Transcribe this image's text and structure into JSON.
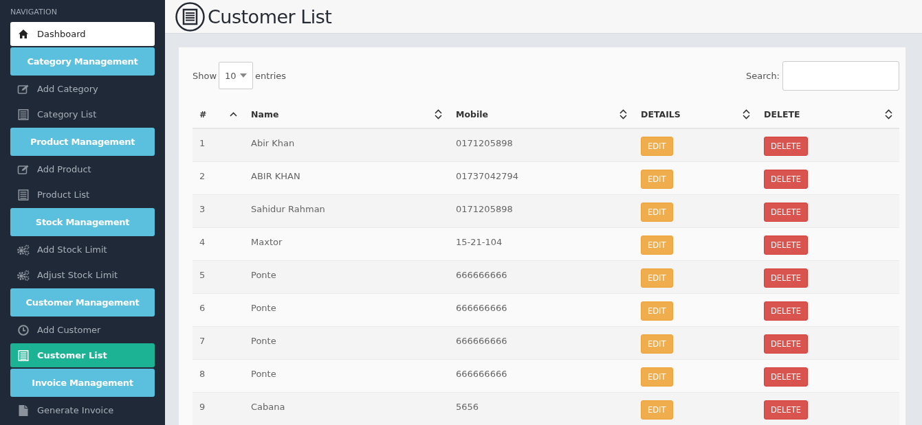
{
  "sidebar": {
    "heading": "NAVIGATION",
    "items": [
      {
        "kind": "home",
        "label": "Dashboard",
        "selected": false
      },
      {
        "kind": "header",
        "label": "Category Management"
      },
      {
        "kind": "link",
        "label": "Add Category",
        "selected": false
      },
      {
        "kind": "link",
        "label": "Category List",
        "selected": false
      },
      {
        "kind": "header",
        "label": "Product Management"
      },
      {
        "kind": "link",
        "label": "Add Product",
        "selected": false
      },
      {
        "kind": "link",
        "label": "Product List",
        "selected": false
      },
      {
        "kind": "header",
        "label": "Stock Management"
      },
      {
        "kind": "link",
        "label": "Add Stock Limit",
        "selected": false
      },
      {
        "kind": "link",
        "label": "Adjust Stock Limit",
        "selected": false
      },
      {
        "kind": "header",
        "label": "Customer Management"
      },
      {
        "kind": "link",
        "label": "Add Customer",
        "selected": false
      },
      {
        "kind": "link",
        "label": "Customer List",
        "selected": true
      },
      {
        "kind": "header",
        "label": "Invoice Management"
      },
      {
        "kind": "link",
        "label": "Generate Invoice",
        "selected": false
      }
    ]
  },
  "page": {
    "title": "Customer List"
  },
  "table_controls": {
    "show_label": "Show",
    "page_size": "10",
    "entries_label": "entries",
    "search_label": "Search:"
  },
  "table": {
    "columns": [
      {
        "label": "#",
        "sorted": true
      },
      {
        "label": "Name",
        "sorted": false
      },
      {
        "label": "Mobile",
        "sorted": false
      },
      {
        "label": "DETAILS",
        "sorted": false
      },
      {
        "label": "DELETE",
        "sorted": false
      }
    ],
    "rows": [
      {
        "number": "1",
        "name": "Abir Khan",
        "mobile": "0171205898",
        "edit": "EDIT",
        "delete": "DELETE"
      },
      {
        "number": "2",
        "name": "ABIR KHAN",
        "mobile": "01737042794",
        "edit": "EDIT",
        "delete": "DELETE"
      },
      {
        "number": "3",
        "name": "Sahidur Rahman",
        "mobile": "0171205898",
        "edit": "EDIT",
        "delete": "DELETE"
      },
      {
        "number": "4",
        "name": "Maxtor",
        "mobile": "15-21-104",
        "edit": "EDIT",
        "delete": "DELETE"
      },
      {
        "number": "5",
        "name": "Ponte",
        "mobile": "666666666",
        "edit": "EDIT",
        "delete": "DELETE"
      },
      {
        "number": "6",
        "name": "Ponte",
        "mobile": "666666666",
        "edit": "EDIT",
        "delete": "DELETE"
      },
      {
        "number": "7",
        "name": "Ponte",
        "mobile": "666666666",
        "edit": "EDIT",
        "delete": "DELETE"
      },
      {
        "number": "8",
        "name": "Ponte",
        "mobile": "666666666",
        "edit": "EDIT",
        "delete": "DELETE"
      },
      {
        "number": "9",
        "name": "Cabana",
        "mobile": "5656",
        "edit": "EDIT",
        "delete": "DELETE"
      }
    ]
  }
}
